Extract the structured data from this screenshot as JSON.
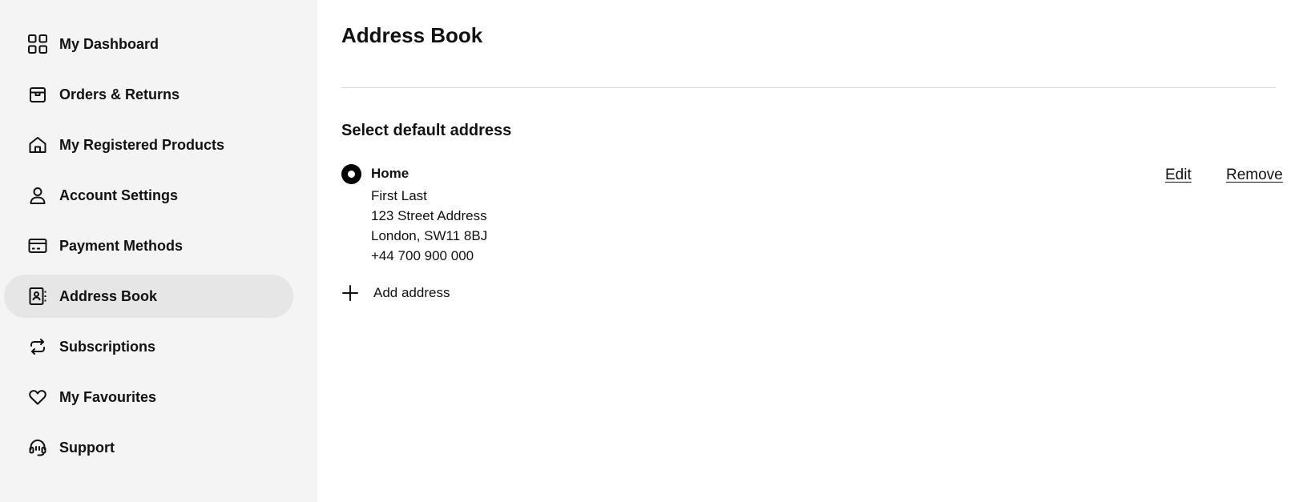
{
  "sidebar": {
    "items": [
      {
        "label": "My Dashboard",
        "icon": "grid-icon",
        "active": false
      },
      {
        "label": "Orders & Returns",
        "icon": "box-icon",
        "active": false
      },
      {
        "label": "My Registered Products",
        "icon": "home-icon",
        "active": false
      },
      {
        "label": "Account Settings",
        "icon": "user-icon",
        "active": false
      },
      {
        "label": "Payment Methods",
        "icon": "credit-card-icon",
        "active": false
      },
      {
        "label": "Address Book",
        "icon": "contact-book-icon",
        "active": true
      },
      {
        "label": "Subscriptions",
        "icon": "repeat-icon",
        "active": false
      },
      {
        "label": "My Favourites",
        "icon": "heart-icon",
        "active": false
      },
      {
        "label": "Support",
        "icon": "headset-icon",
        "active": false
      }
    ]
  },
  "main": {
    "title": "Address Book",
    "section_title": "Select default address",
    "address": {
      "name": "Home",
      "selected": true,
      "lines": [
        "First Last",
        "123 Street Address",
        "London, SW11 8BJ",
        "+44 700 900 000"
      ],
      "edit_label": "Edit",
      "remove_label": "Remove"
    },
    "add_address_label": "Add address"
  }
}
